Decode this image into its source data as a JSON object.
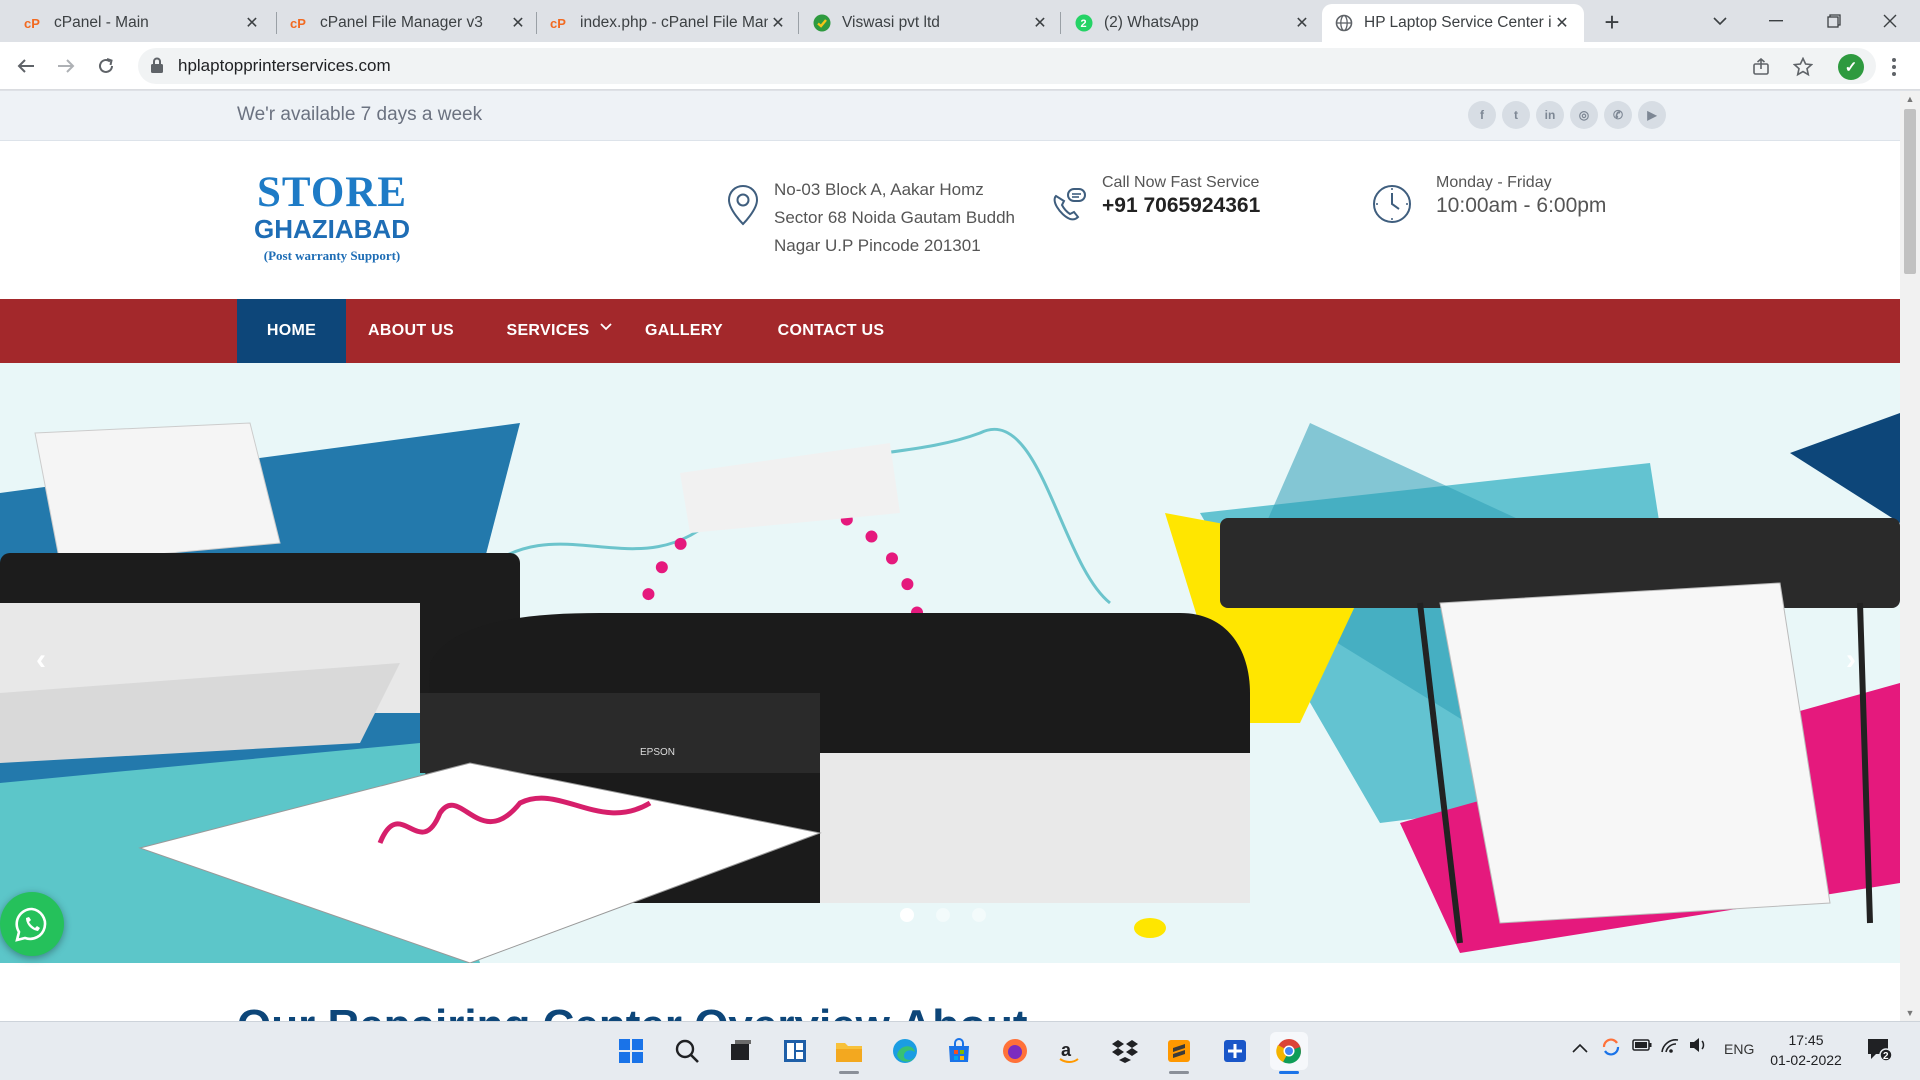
{
  "browser": {
    "tabs": [
      {
        "title": "cPanel - Main",
        "icon": "cpanel-icon",
        "active": false
      },
      {
        "title": "cPanel File Manager v3",
        "icon": "cpanel-icon",
        "active": false
      },
      {
        "title": "index.php - cPanel File Man",
        "icon": "cpanel-icon",
        "active": false
      },
      {
        "title": "Viswasi pvt ltd",
        "icon": "check-badge-icon",
        "active": false
      },
      {
        "title": "(2) WhatsApp",
        "icon": "whatsapp-icon",
        "active": false
      },
      {
        "title": "HP Laptop Service Center ir",
        "icon": "globe-icon",
        "active": true
      }
    ],
    "new_tab_label": "+",
    "url": "hplaptopprinterservices.com",
    "extension_label": "✓"
  },
  "site": {
    "topbar": {
      "availability": "We'r available 7 days a week",
      "socials": [
        {
          "name": "facebook-icon",
          "glyph": "f"
        },
        {
          "name": "twitter-icon",
          "glyph": "t"
        },
        {
          "name": "linkedin-icon",
          "glyph": "in"
        },
        {
          "name": "instagram-icon",
          "glyph": "◎"
        },
        {
          "name": "whatsapp-social-icon",
          "glyph": "✆"
        },
        {
          "name": "youtube-icon",
          "glyph": "▶"
        }
      ]
    },
    "logo": {
      "line1": "STORE",
      "line2": "GHAZIABAD",
      "line3": "(Post warranty Support)"
    },
    "address": {
      "line1": "No-03 Block A, Aakar Homz",
      "line2": "Sector 68 Noida Gautam Buddh",
      "line3": "Nagar U.P Pincode 201301"
    },
    "call": {
      "label": "Call Now Fast Service",
      "number": "+91 7065924361"
    },
    "hours": {
      "label": "Monday - Friday",
      "value": "10:00am - 6:00pm"
    },
    "nav": [
      {
        "label": "HOME",
        "active": true
      },
      {
        "label": "ABOUT US",
        "active": false
      },
      {
        "label": "SERVICES",
        "active": false,
        "dropdown": true
      },
      {
        "label": "GALLERY",
        "active": false
      },
      {
        "label": "CONTACT US",
        "active": false
      }
    ],
    "slider": {
      "prev": "‹",
      "next": "›",
      "printer_brand": "EPSON",
      "slide_count": 3,
      "active_slide": 1
    },
    "section_heading_partial": "Our Repairing Center Overview About"
  },
  "taskbar": {
    "apps": [
      "start-icon",
      "search-icon",
      "task-view-icon",
      "widgets-icon",
      "file-explorer-icon",
      "edge-icon",
      "store-icon",
      "firefox-icon",
      "amazon-icon",
      "dropbox-icon",
      "sublime-icon",
      "plus-app-icon",
      "chrome-icon"
    ],
    "language": "ENG",
    "time": "17:45",
    "date": "01-02-2022",
    "notification_count": "2"
  }
}
